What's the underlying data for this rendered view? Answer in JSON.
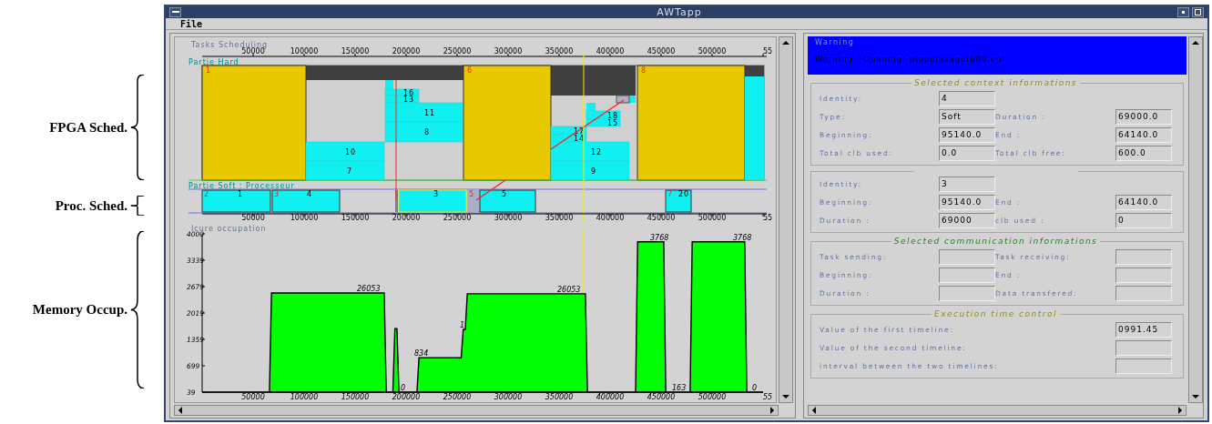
{
  "annotations": [
    {
      "label": "FPGA Sched."
    },
    {
      "label": "Proc. Sched."
    },
    {
      "label": "Memory Occup."
    }
  ],
  "window": {
    "title": "AWTapp"
  },
  "menu": [
    "File"
  ],
  "scheduling": {
    "title": "Tasks Scheduling",
    "hard_label": "Partie Hard",
    "soft_label": "Partie Soft : Processeur",
    "axis_ticks": [
      "50000",
      "100000",
      "150000",
      "200000",
      "250000",
      "300000",
      "350000",
      "400000",
      "450000",
      "500000",
      "55"
    ],
    "hard_contexts": [
      "1",
      "6",
      "8"
    ],
    "hard_tasks": [
      "16",
      "13",
      "11",
      "8",
      "10",
      "7",
      "18",
      "15",
      "17",
      "14",
      "12",
      "9"
    ],
    "soft_contexts": [
      "2",
      "3",
      "5",
      "7"
    ],
    "soft_tasks": [
      "1",
      "4",
      "3",
      "5",
      "20"
    ],
    "bottom_ticks": [
      "50000",
      "100000",
      "150000",
      "200000",
      "250000",
      "300000",
      "350000",
      "400000",
      "450000",
      "500000",
      "55"
    ]
  },
  "memory": {
    "title": "Icure occupation",
    "x_end_label": "55",
    "chart_data": {
      "type": "area",
      "xlim": [
        0,
        550000
      ],
      "ylim": [
        39,
        4000
      ],
      "x": [
        0,
        66000,
        68000,
        178500,
        180500,
        187000,
        189000,
        191000,
        193000,
        210600,
        212600,
        254000,
        256000,
        258000,
        260000,
        375800,
        377800,
        425000,
        427000,
        452600,
        454600,
        478500,
        480500,
        532000,
        534000,
        550000
      ],
      "series": [
        {
          "color": "#00ff00",
          "values": [
            39,
            39,
            2520,
            2520,
            39,
            39,
            1630,
            1630,
            39,
            39,
            900,
            900,
            1610,
            1610,
            2500,
            2500,
            39,
            39,
            3800,
            3800,
            39,
            39,
            3800,
            3800,
            39,
            39
          ]
        }
      ],
      "xticks": [
        50000,
        100000,
        150000,
        200000,
        250000,
        300000,
        350000,
        400000,
        450000,
        500000
      ],
      "yticks": [
        39,
        699,
        1359,
        2019,
        2679,
        3339,
        4000
      ],
      "ref_lines": [
        {
          "axis": "x",
          "value": 374100,
          "color": "#f0f000"
        }
      ],
      "annotations": [
        {
          "x": 151800,
          "y": 2520,
          "text": "26053"
        },
        {
          "x": 194600,
          "y": 39,
          "text": "0"
        },
        {
          "x": 208000,
          "y": 900,
          "text": "834"
        },
        {
          "x": 252700,
          "y": 1610,
          "text": "1"
        },
        {
          "x": 348200,
          "y": 2500,
          "text": "26053"
        },
        {
          "x": 439300,
          "y": 3800,
          "text": "3768"
        },
        {
          "x": 460700,
          "y": 39,
          "text": "163"
        },
        {
          "x": 520500,
          "y": 3800,
          "text": "3768"
        },
        {
          "x": 539300,
          "y": 39,
          "text": "0"
        }
      ]
    }
  },
  "warning": {
    "title": "Warning",
    "message": "Warning : Opening: pippoinzagui600.epi"
  },
  "groups": [
    {
      "title": "Selected context informations",
      "kind": "context",
      "rows": [
        [
          {
            "label": "Identity:",
            "value": "4"
          }
        ],
        [
          {
            "label": "Type:",
            "value": "Soft"
          },
          {
            "label": "Duration :",
            "value": "69000.0"
          }
        ],
        [
          {
            "label": "Beginning:",
            "value": "95140.0"
          },
          {
            "label": "End :",
            "value": "64140.0"
          }
        ],
        [
          {
            "label": "Total clb used:",
            "value": "0.0"
          },
          {
            "label": "Total clb free:",
            "value": "600.0"
          }
        ]
      ]
    },
    {
      "kind": "task",
      "rows": [
        [
          {
            "label": "Identity:",
            "value": "3"
          }
        ],
        [
          {
            "label": "Beginning:",
            "value": "95140.0"
          },
          {
            "label": "End :",
            "value": "64140.0"
          }
        ],
        [
          {
            "label": "Duration :",
            "value": "69000"
          },
          {
            "label": "clb used :",
            "value": "0"
          }
        ]
      ]
    },
    {
      "title": "Selected communication informations",
      "kind": "communication",
      "rows": [
        [
          {
            "label": "Task sending:"
          },
          {
            "label": "Task receiving:"
          }
        ],
        [
          {
            "label": "Beginning:"
          },
          {
            "label": "End :"
          }
        ],
        [
          {
            "label": "Duration :"
          },
          {
            "label": "Data transfered:"
          }
        ]
      ]
    },
    {
      "title": "Execution time control",
      "kind": "time",
      "rows": [
        [
          {
            "label": "Value of the first timeline:",
            "value": "0991.45"
          }
        ],
        [
          {
            "label": "Value of the second timeline:"
          }
        ],
        [
          {
            "label": "interval between the two timelines:"
          }
        ]
      ]
    }
  ]
}
